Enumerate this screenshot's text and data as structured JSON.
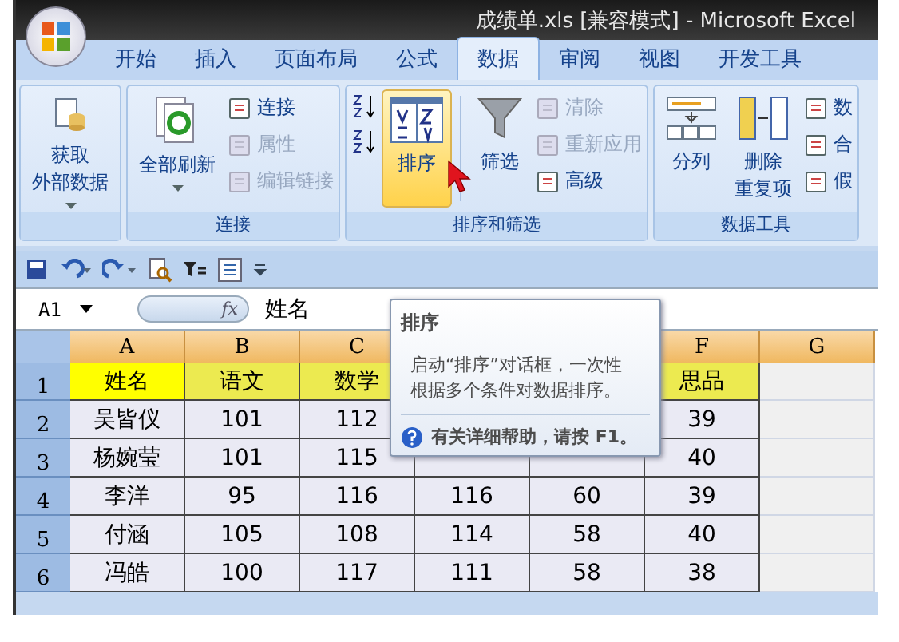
{
  "window": {
    "title": "成绩单.xls  [兼容模式]  -  Microsoft Excel"
  },
  "tabs": [
    {
      "label": "开始",
      "selected": false
    },
    {
      "label": "插入",
      "selected": false
    },
    {
      "label": "页面布局",
      "selected": false
    },
    {
      "label": "公式",
      "selected": false
    },
    {
      "label": "数据",
      "selected": true
    },
    {
      "label": "审阅",
      "selected": false
    },
    {
      "label": "视图",
      "selected": false
    },
    {
      "label": "开发工具",
      "selected": false
    }
  ],
  "ribbon": {
    "groups": [
      {
        "columns": [
          {
            "kind": "large",
            "label": [
              "获取",
              "外部数据"
            ],
            "dropdown": true,
            "disabled": false,
            "highlighted": false
          }
        ]
      },
      {
        "label": "连接",
        "columns": [
          {
            "kind": "large",
            "label": [
              "全部刷新"
            ],
            "dropdown": true,
            "disabled": false,
            "highlighted": false
          },
          {
            "kind": "stack",
            "items": [
              {
                "label": "连接",
                "disabled": false
              },
              {
                "label": "属性",
                "disabled": true
              },
              {
                "label": "编辑链接",
                "disabled": true
              }
            ]
          }
        ]
      },
      {
        "label": "排序和筛选",
        "columns": [
          {
            "kind": "sort_pair"
          },
          {
            "kind": "large",
            "label": [
              "排序"
            ],
            "disabled": false,
            "highlighted": true
          },
          {
            "kind": "separator"
          },
          {
            "kind": "large",
            "label": [
              "筛选"
            ],
            "disabled": false,
            "highlighted": false
          },
          {
            "kind": "stack",
            "items": [
              {
                "label": "清除",
                "disabled": true
              },
              {
                "label": "重新应用",
                "disabled": true
              },
              {
                "label": "高级",
                "disabled": false
              }
            ]
          }
        ]
      },
      {
        "label": "数据工具",
        "columns": [
          {
            "kind": "large",
            "label": [
              "分列"
            ],
            "disabled": false,
            "highlighted": false
          },
          {
            "kind": "large",
            "label": [
              "删除",
              "重复项"
            ],
            "disabled": false,
            "highlighted": false
          },
          {
            "kind": "stack",
            "items": [
              {
                "label": "数",
                "disabled": false
              },
              {
                "label": "合",
                "disabled": false
              },
              {
                "label": "假",
                "disabled": false
              }
            ]
          }
        ]
      }
    ]
  },
  "formula_bar": {
    "name_box": "A1",
    "fx": "fx",
    "value": "姓名"
  },
  "sheet": {
    "columns": [
      "A",
      "B",
      "C",
      null,
      null,
      "F",
      "G"
    ],
    "rows": [
      {
        "number": "1",
        "cells": [
          "姓名",
          "语文",
          "数学",
          null,
          null,
          "思品",
          null
        ]
      },
      {
        "number": "2",
        "cells": [
          "吴皆仪",
          "101",
          "112",
          null,
          null,
          "39",
          null
        ]
      },
      {
        "number": "3",
        "cells": [
          "杨婉莹",
          "101",
          "115",
          null,
          null,
          "40",
          null
        ]
      },
      {
        "number": "4",
        "cells": [
          "李洋",
          "95",
          "116",
          "116",
          "60",
          "39",
          null
        ]
      },
      {
        "number": "5",
        "cells": [
          "付涵",
          "105",
          "108",
          "114",
          "58",
          "40",
          null
        ]
      },
      {
        "number": "6",
        "cells": [
          "冯皓",
          "100",
          "117",
          "111",
          "58",
          "38",
          null
        ]
      }
    ]
  },
  "tooltip": {
    "title": "排序",
    "body": "启动“排序”对话框，一次性根据多个条件对数据排序。",
    "help": "有关详细帮助，请按 F1。"
  }
}
